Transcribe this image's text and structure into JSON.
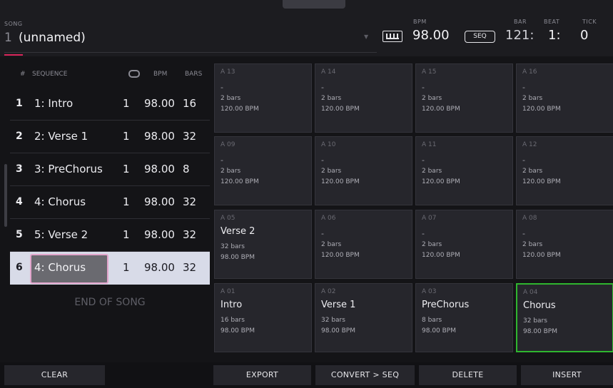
{
  "header": {
    "song_caption": "SONG",
    "song_number": "1",
    "song_name": "(unnamed)",
    "bpm_caption": "BPM",
    "bpm_value": "98.00",
    "seq_badge": "SEQ",
    "bar_caption": "BAR",
    "beat_caption": "BEAT",
    "tick_caption": "TICK",
    "bar_value": "121:",
    "beat_value": "1:",
    "tick_value": "0"
  },
  "list": {
    "headers": {
      "num": "#",
      "sequence": "SEQUENCE",
      "bpm": "BPM",
      "bars": "BARS"
    },
    "rows": [
      {
        "num": "1",
        "name": "1: Intro",
        "loop": "1",
        "bpm": "98.00",
        "bars": "16"
      },
      {
        "num": "2",
        "name": "2: Verse 1",
        "loop": "1",
        "bpm": "98.00",
        "bars": "32"
      },
      {
        "num": "3",
        "name": "3: PreChorus",
        "loop": "1",
        "bpm": "98.00",
        "bars": "8"
      },
      {
        "num": "4",
        "name": "4: Chorus",
        "loop": "1",
        "bpm": "98.00",
        "bars": "32"
      },
      {
        "num": "5",
        "name": "5: Verse 2",
        "loop": "1",
        "bpm": "98.00",
        "bars": "32"
      },
      {
        "num": "6",
        "name": "4: Chorus",
        "loop": "1",
        "bpm": "98.00",
        "bars": "32"
      }
    ],
    "end_label": "END OF SONG"
  },
  "pads": [
    {
      "id": "A 13",
      "name": "-",
      "bars": "2 bars",
      "bpm": "120.00 BPM"
    },
    {
      "id": "A 14",
      "name": "-",
      "bars": "2 bars",
      "bpm": "120.00 BPM"
    },
    {
      "id": "A 15",
      "name": "-",
      "bars": "2 bars",
      "bpm": "120.00 BPM"
    },
    {
      "id": "A 16",
      "name": "-",
      "bars": "2 bars",
      "bpm": "120.00 BPM"
    },
    {
      "id": "A 09",
      "name": "-",
      "bars": "2 bars",
      "bpm": "120.00 BPM"
    },
    {
      "id": "A 10",
      "name": "-",
      "bars": "2 bars",
      "bpm": "120.00 BPM"
    },
    {
      "id": "A 11",
      "name": "-",
      "bars": "2 bars",
      "bpm": "120.00 BPM"
    },
    {
      "id": "A 12",
      "name": "-",
      "bars": "2 bars",
      "bpm": "120.00 BPM"
    },
    {
      "id": "A 05",
      "name": "Verse 2",
      "bars": "32 bars",
      "bpm": "98.00 BPM"
    },
    {
      "id": "A 06",
      "name": "-",
      "bars": "2 bars",
      "bpm": "120.00 BPM"
    },
    {
      "id": "A 07",
      "name": "-",
      "bars": "2 bars",
      "bpm": "120.00 BPM"
    },
    {
      "id": "A 08",
      "name": "-",
      "bars": "2 bars",
      "bpm": "120.00 BPM"
    },
    {
      "id": "A 01",
      "name": "Intro",
      "bars": "16 bars",
      "bpm": "98.00 BPM"
    },
    {
      "id": "A 02",
      "name": "Verse 1",
      "bars": "32 bars",
      "bpm": "98.00 BPM"
    },
    {
      "id": "A 03",
      "name": "PreChorus",
      "bars": "8 bars",
      "bpm": "98.00 BPM"
    },
    {
      "id": "A 04",
      "name": "Chorus",
      "bars": "32 bars",
      "bpm": "98.00 BPM"
    }
  ],
  "buttons": {
    "clear": "CLEAR",
    "export": "EXPORT",
    "convert": "CONVERT > SEQ",
    "delete": "DELETE",
    "insert": "INSERT"
  },
  "colors": {
    "accent": "#d8255a",
    "active_pad": "#2fb62f",
    "selected_row": "#d8dbe8"
  }
}
